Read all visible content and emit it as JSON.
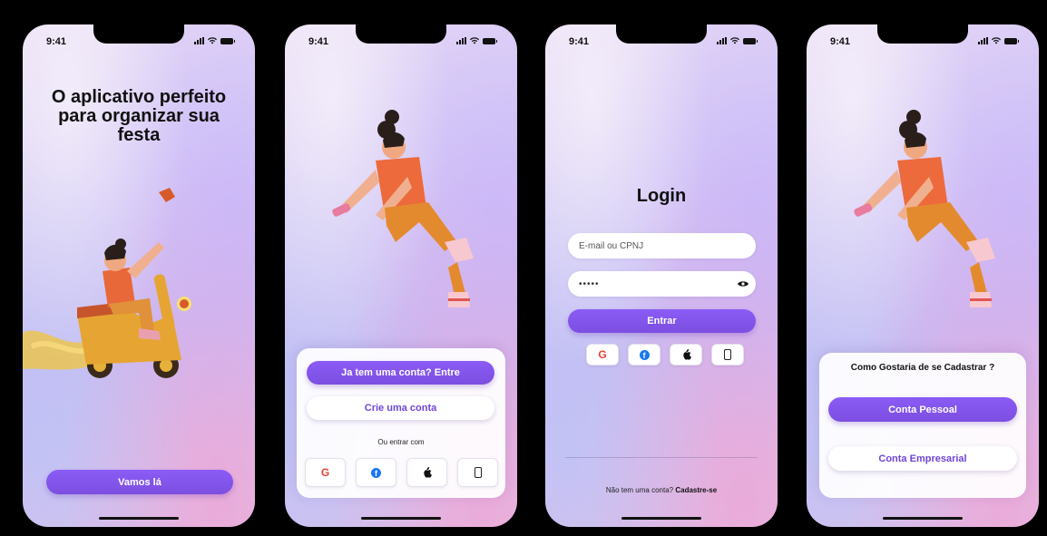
{
  "status_time": "9:41",
  "screen1": {
    "title": "O aplicativo perfeito para organizar sua festa",
    "cta_label": "Vamos lá"
  },
  "screen2": {
    "login_label": "Ja tem uma conta? Entre",
    "create_label": "Crie uma conta",
    "or_text": "Ou entrar com"
  },
  "screen3": {
    "title": "Login",
    "email_placeholder": "E-mail ou CPNJ",
    "password_value": "•••••",
    "submit_label": "Entrar",
    "no_account_text": "Não tem uma conta?",
    "signup_link": "Cadastre-se"
  },
  "screen4": {
    "question": "Como Gostaria de se Cadastrar ?",
    "personal_label": "Conta Pessoal",
    "business_label": "Conta Empresarial"
  },
  "social": {
    "google_letter": "G",
    "facebook_letter": "f",
    "icons": [
      "google-icon",
      "facebook-icon",
      "apple-icon",
      "phone-icon"
    ]
  },
  "colors": {
    "primary": "#8b5cf6",
    "primary_text": "#6f45d6",
    "background_pink": "#e4c0e6",
    "background_lavender": "#cdbcf0"
  }
}
